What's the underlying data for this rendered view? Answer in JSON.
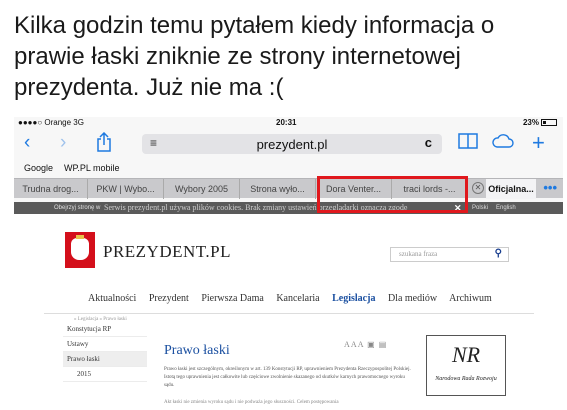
{
  "caption": "Kilka godzin temu pytałem kiedy informacja o prawie łaski zniknie ze strony internetowej prezydenta. Już nie ma :(",
  "statusbar": {
    "carrier": "●●●●○ Orange  3G",
    "time": "20:31",
    "battery": "23%"
  },
  "toolbar": {
    "back_icon": "chevron-left-icon",
    "forward_icon": "chevron-right-icon",
    "share_icon": "share-icon",
    "reader_icon": "reader-icon",
    "url": "prezydent.pl",
    "reload_icon": "reload-icon",
    "bookmarks_icon": "book-icon",
    "cloud_icon": "cloud-icon",
    "new_tab_icon": "plus-icon",
    "accent_color": "#1f7ae0"
  },
  "bookmarks": [
    "Google",
    "WP.PL mobile"
  ],
  "tabs": [
    "Trudna drog...",
    "PKW | Wybo...",
    "Wybory 2005",
    "Strona wyło...",
    "Dora Venter...",
    "traci lords -...",
    "Oficjalna..."
  ],
  "more_tabs": "•••",
  "cookie_bar": {
    "left": "Obejrzyj stronę w",
    "message": "Serwis prezydent.pl używa plików cookies. Brak zmiany ustawień przeglądarki oznacza zgodę",
    "close": "✕",
    "languages": [
      "Polski",
      "English"
    ]
  },
  "highlight_color": "#e0181d",
  "site": {
    "logo": "PREZYDENT.PL",
    "search_placeholder": "szukana fraza",
    "nav": [
      "Aktualności",
      "Prezydent",
      "Pierwsza Dama",
      "Kancelaria",
      "Legislacja",
      "Dla mediów",
      "Archiwum"
    ],
    "active_nav": "Legislacja",
    "breadcrumb": "» Legislacja  »  Prawo łaski",
    "side_menu": [
      "Konstytucja RP",
      "Ustawy",
      "Prawo łaski",
      "2015"
    ],
    "article_title": "Prawo łaski",
    "tools": "A A A",
    "paragraph": "Prawo łaski jest szczególnym, określonym w art. 139 Konstytucji RP, uprawnieniem Prezydenta Rzeczypospolitej Polskiej. Istotą tego uprawnienia jest całkowite lub częściowe zwolnienie skazanego od skutków karnych prawomocnego wyroku sądu.",
    "paragraph2": "Akt łaski nie zmienia wyroku sądu i nie podważa jego słuszności. Celem postępowania",
    "nrr": {
      "monogram": "NR",
      "name": "Narodowa Rada Rozwoju"
    },
    "brand_color": "#1a4fa0",
    "emblem_color": "#d40f1b"
  }
}
